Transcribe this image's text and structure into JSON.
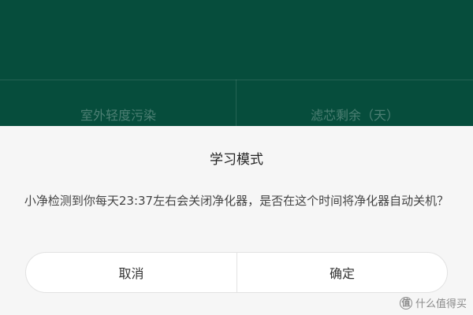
{
  "background": {
    "labels": {
      "left": "室外轻度污染",
      "right": "滤芯剩余（天）"
    }
  },
  "dialog": {
    "title": "学习模式",
    "message": "小净检测到你每天23:37左右会关闭净化器，是否在这个时间将净化器自动关机？",
    "buttons": {
      "cancel": "取消",
      "confirm": "确定"
    }
  },
  "watermark": {
    "icon_glyph": "值",
    "text": "什么值得买"
  },
  "colors": {
    "background_green": "#064d3c",
    "dialog_bg": "#f6f6f6"
  }
}
